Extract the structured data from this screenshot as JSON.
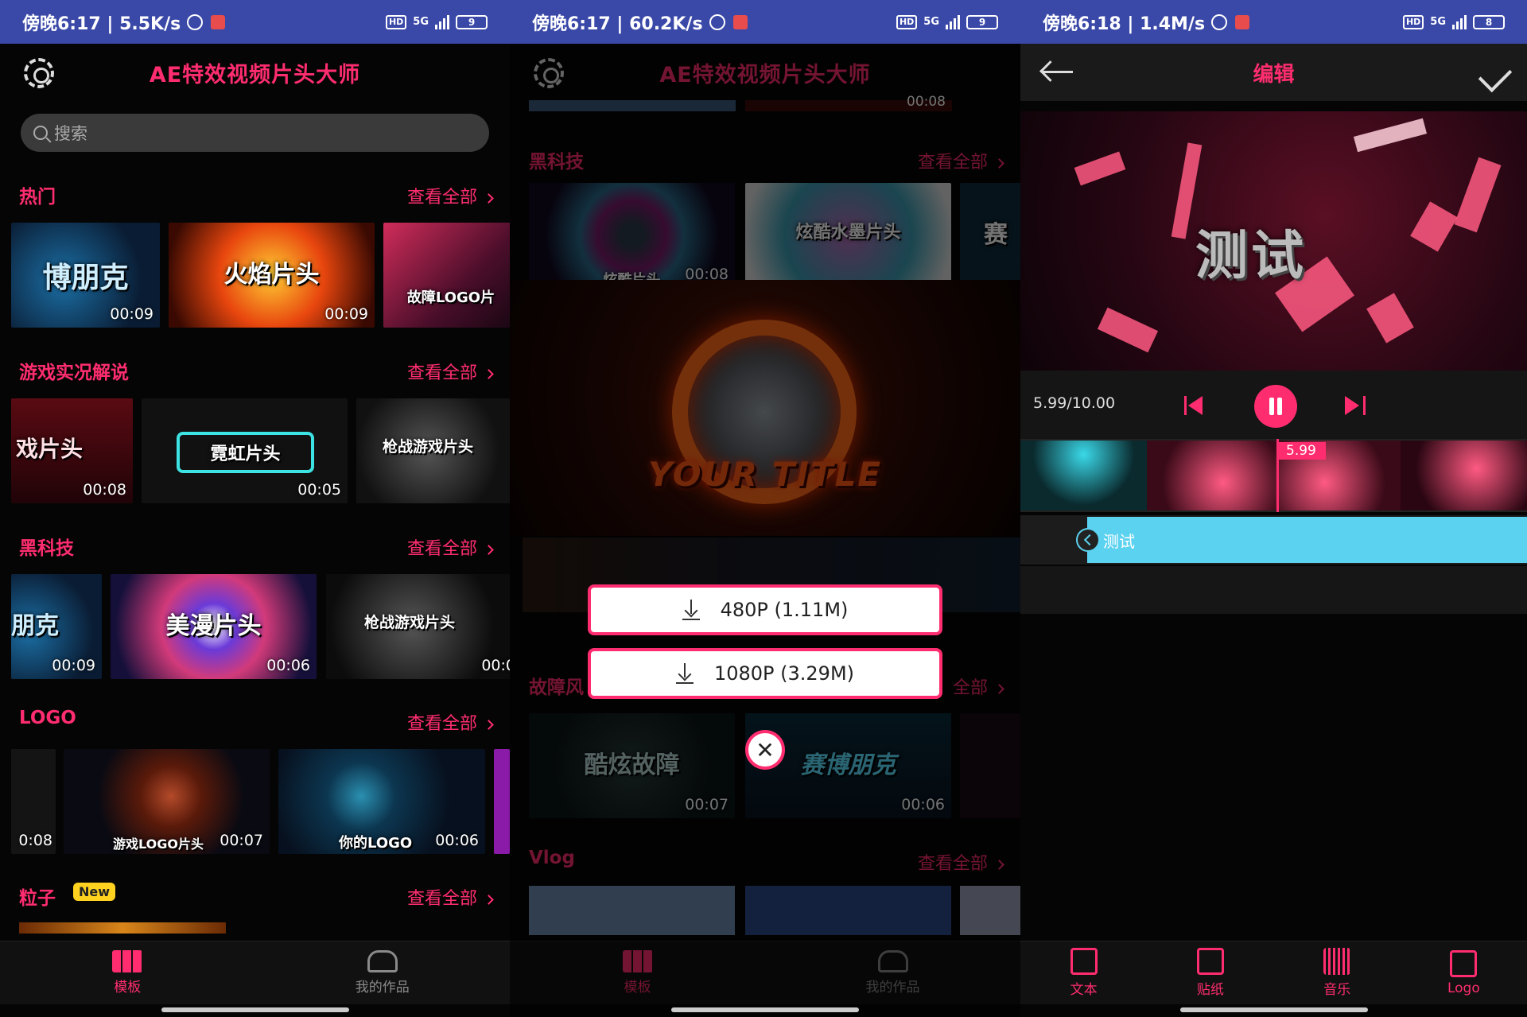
{
  "screens": [
    {
      "status": {
        "time": "傍晚6:17 | 5.5K/s",
        "hd": "HD",
        "net": "5G",
        "battery": "9"
      },
      "app_title": "AE特效视频片头大师",
      "search": {
        "placeholder": "搜索"
      },
      "sections": [
        {
          "title": "热门",
          "more": "查看全部",
          "thumbs": [
            {
              "label": "博朋克",
              "duration": "00:09"
            },
            {
              "label": "火焰片头",
              "duration": "00:09"
            },
            {
              "label": "故障LOGO片",
              "duration": ""
            }
          ]
        },
        {
          "title": "游戏实况解说",
          "more": "查看全部",
          "thumbs": [
            {
              "label": "戏片头",
              "duration": "00:08"
            },
            {
              "label": "霓虹片头",
              "duration": "00:05"
            },
            {
              "label": "枪战游戏片头",
              "duration": ""
            }
          ]
        },
        {
          "title": "黑科技",
          "more": "查看全部",
          "thumbs": [
            {
              "label": "朋克",
              "duration": "00:09"
            },
            {
              "label": "美漫片头",
              "duration": "00:06"
            },
            {
              "label": "枪战游戏片头",
              "duration": "00:0"
            }
          ]
        },
        {
          "title": "LOGO",
          "more": "查看全部",
          "thumbs": [
            {
              "label": "",
              "duration": "0:08"
            },
            {
              "label": "游戏LOGO片头",
              "duration": "00:07"
            },
            {
              "label": "你的LOGO",
              "duration": "00:06"
            }
          ]
        },
        {
          "title": "粒子",
          "badge": "New",
          "more": "查看全部"
        }
      ],
      "nav": [
        {
          "label": "模板"
        },
        {
          "label": "我的作品"
        }
      ]
    },
    {
      "status": {
        "time": "傍晚6:17 | 60.2K/s",
        "hd": "HD",
        "net": "5G",
        "battery": "9"
      },
      "app_title": "AE特效视频片头大师",
      "top_duration": "00:08",
      "sections": [
        {
          "title": "黑科技",
          "more": "查看全部",
          "thumbs": [
            {
              "label": "炫酷片头",
              "duration": "00:08"
            },
            {
              "label": "炫酷水墨片头",
              "duration": ""
            },
            {
              "label": "赛",
              "duration": ""
            }
          ]
        },
        {
          "title": "故障风",
          "more": "全部",
          "thumbs": [
            {
              "label": "酷炫故障",
              "duration": "00:07"
            },
            {
              "label": "赛博朋克",
              "duration": "00:06"
            },
            {
              "label": "",
              "duration": ""
            }
          ]
        },
        {
          "title": "Vlog",
          "more": "查看全部"
        }
      ],
      "featured_title": "YOUR TITLE",
      "download_options": [
        {
          "label": "480P (1.11M)"
        },
        {
          "label": "1080P (3.29M)"
        }
      ],
      "close_glyph": "✕",
      "nav": [
        {
          "label": "模板"
        },
        {
          "label": "我的作品"
        }
      ]
    },
    {
      "status": {
        "time": "傍晚6:18 | 1.4M/s",
        "hd": "HD",
        "net": "5G",
        "battery": "8"
      },
      "title": "编辑",
      "preview_text": "测试",
      "time_readout": "5.99/10.00",
      "playhead_label": "5.99",
      "playhead_fraction": 0.599,
      "text_track_label": "测试",
      "tools": [
        {
          "label": "文本"
        },
        {
          "label": "贴纸"
        },
        {
          "label": "音乐"
        },
        {
          "label": "Logo"
        }
      ]
    }
  ],
  "colors": {
    "accent": "#ff2d6f",
    "statusbar": "#3a49a8",
    "track": "#5bd2ef",
    "badge": "#ffd21f"
  }
}
